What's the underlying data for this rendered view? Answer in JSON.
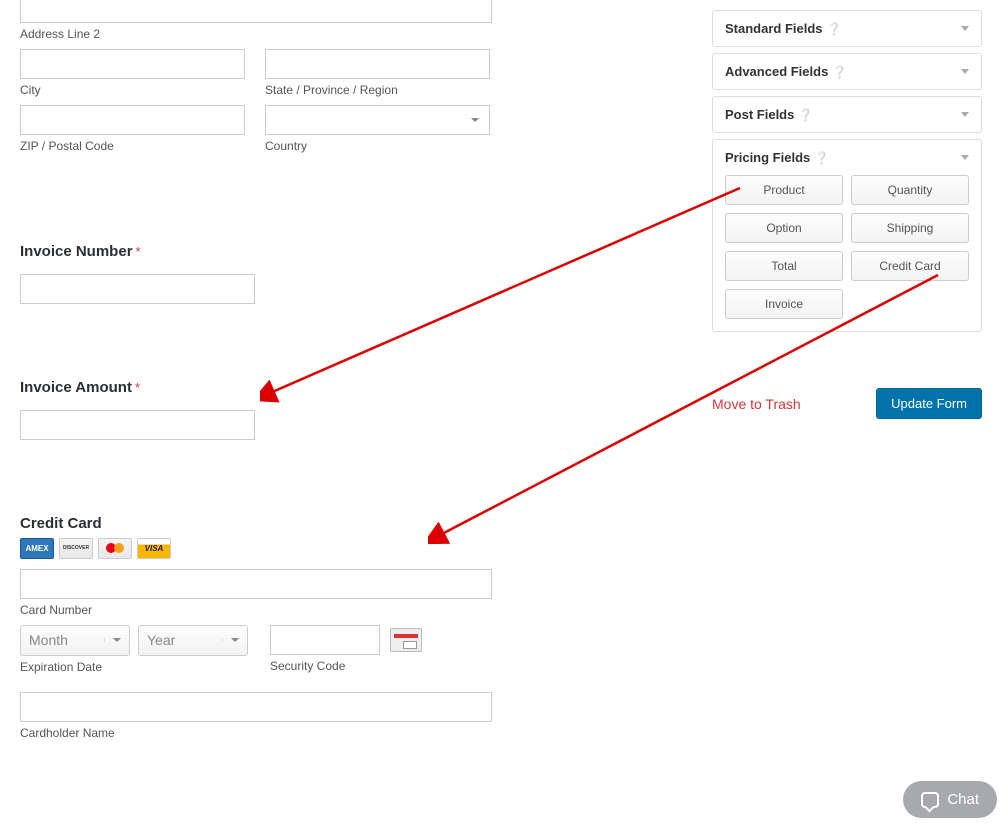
{
  "address": {
    "line2_label": "Address Line 2",
    "city_label": "City",
    "state_label": "State / Province / Region",
    "zip_label": "ZIP / Postal Code",
    "country_label": "Country"
  },
  "invoice_number": {
    "label": "Invoice Number"
  },
  "invoice_amount": {
    "label": "Invoice Amount"
  },
  "credit_card": {
    "label": "Credit Card",
    "card_number_label": "Card Number",
    "expiration_label": "Expiration Date",
    "security_label": "Security Code",
    "cardholder_label": "Cardholder Name",
    "month_placeholder": "Month",
    "year_placeholder": "Year",
    "icons": {
      "amex": "AMEX",
      "discover": "DISCOVER",
      "visa": "VISA"
    }
  },
  "sidebar": {
    "sections": [
      {
        "title": "Standard Fields"
      },
      {
        "title": "Advanced Fields"
      },
      {
        "title": "Post Fields"
      },
      {
        "title": "Pricing Fields"
      }
    ],
    "pricing_fields": [
      "Product",
      "Quantity",
      "Option",
      "Shipping",
      "Total",
      "Credit Card",
      "Invoice"
    ]
  },
  "actions": {
    "trash": "Move to Trash",
    "update": "Update Form"
  },
  "chat": {
    "label": "Chat"
  }
}
